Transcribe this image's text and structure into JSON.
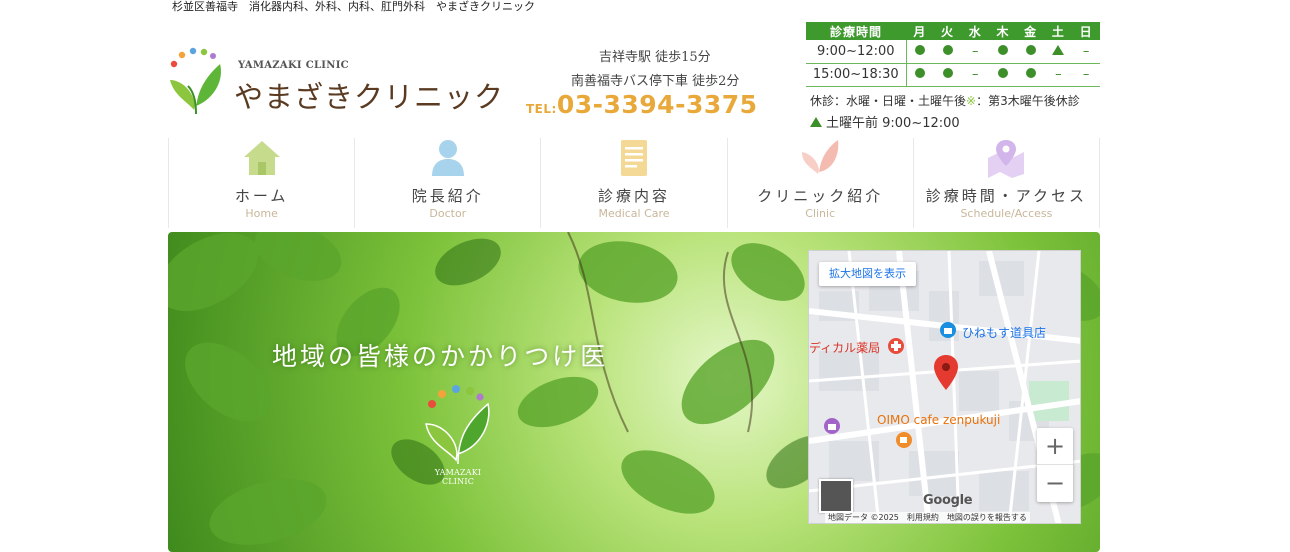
{
  "topline": "杉並区善福寺　消化器内科、外科、内科、肛門外科　やまざきクリニック",
  "logo": {
    "en": "YAMAZAKI CLINIC",
    "jp": "やまざきクリニック"
  },
  "access": {
    "line1": "吉祥寺駅 徒歩15分",
    "line2": "南善福寺バス停下車 徒歩2分",
    "tel_label": "TEL:",
    "tel_number": "03-3394-3375"
  },
  "schedule": {
    "header": [
      "診療時間",
      "月",
      "火",
      "水",
      "木",
      "金",
      "土",
      "日"
    ],
    "rows": [
      {
        "time": "9:00~12:00",
        "cells": [
          "dot",
          "dot",
          "dash",
          "dot",
          "dot",
          "tri",
          "dash"
        ]
      },
      {
        "time": "15:00~18:30",
        "cells": [
          "dot",
          "dot",
          "dash",
          "dot",
          "dot",
          "dash",
          "dash"
        ]
      }
    ],
    "dash_symbol": "–",
    "note_closed": "休診：水曜・日曜・土曜午後",
    "note_mark": "※",
    "note_extra": "：第3木曜午後休診",
    "note_saturday": "土曜午前 9:00~12:00"
  },
  "nav": [
    {
      "jp": "ホーム",
      "en": "Home",
      "icon": "home-icon",
      "color": "#b5d36c"
    },
    {
      "jp": "院長紹介",
      "en": "Doctor",
      "icon": "doctor-icon",
      "color": "#9ccbe6"
    },
    {
      "jp": "診療内容",
      "en": "Medical Care",
      "icon": "document-icon",
      "color": "#f0d38a"
    },
    {
      "jp": "クリニック紹介",
      "en": "Clinic",
      "icon": "leaf-icon",
      "color": "#f2b3a7"
    },
    {
      "jp": "診療時間・アクセス",
      "en": "Schedule/Access",
      "icon": "map-pin-icon",
      "color": "#d4b8e8"
    }
  ],
  "hero": {
    "tagline": "地域の皆様のかかりつけ医",
    "logo_text": "YAMAZAKI CLINIC"
  },
  "map": {
    "enlarge_button": "拡大地図を表示",
    "place_store": "ひねもす道具店",
    "place_pharmacy": "ディカル薬局",
    "place_cafe": "OIMO cafe zenpukuji",
    "zoom_in": "+",
    "zoom_out": "−",
    "google": "Google",
    "footer": "地図データ ©2025　利用規約　地図の誤りを報告する"
  },
  "colors": {
    "green": "#3e9a2d",
    "tel": "#e8a93a",
    "brown": "#5a3b22"
  }
}
